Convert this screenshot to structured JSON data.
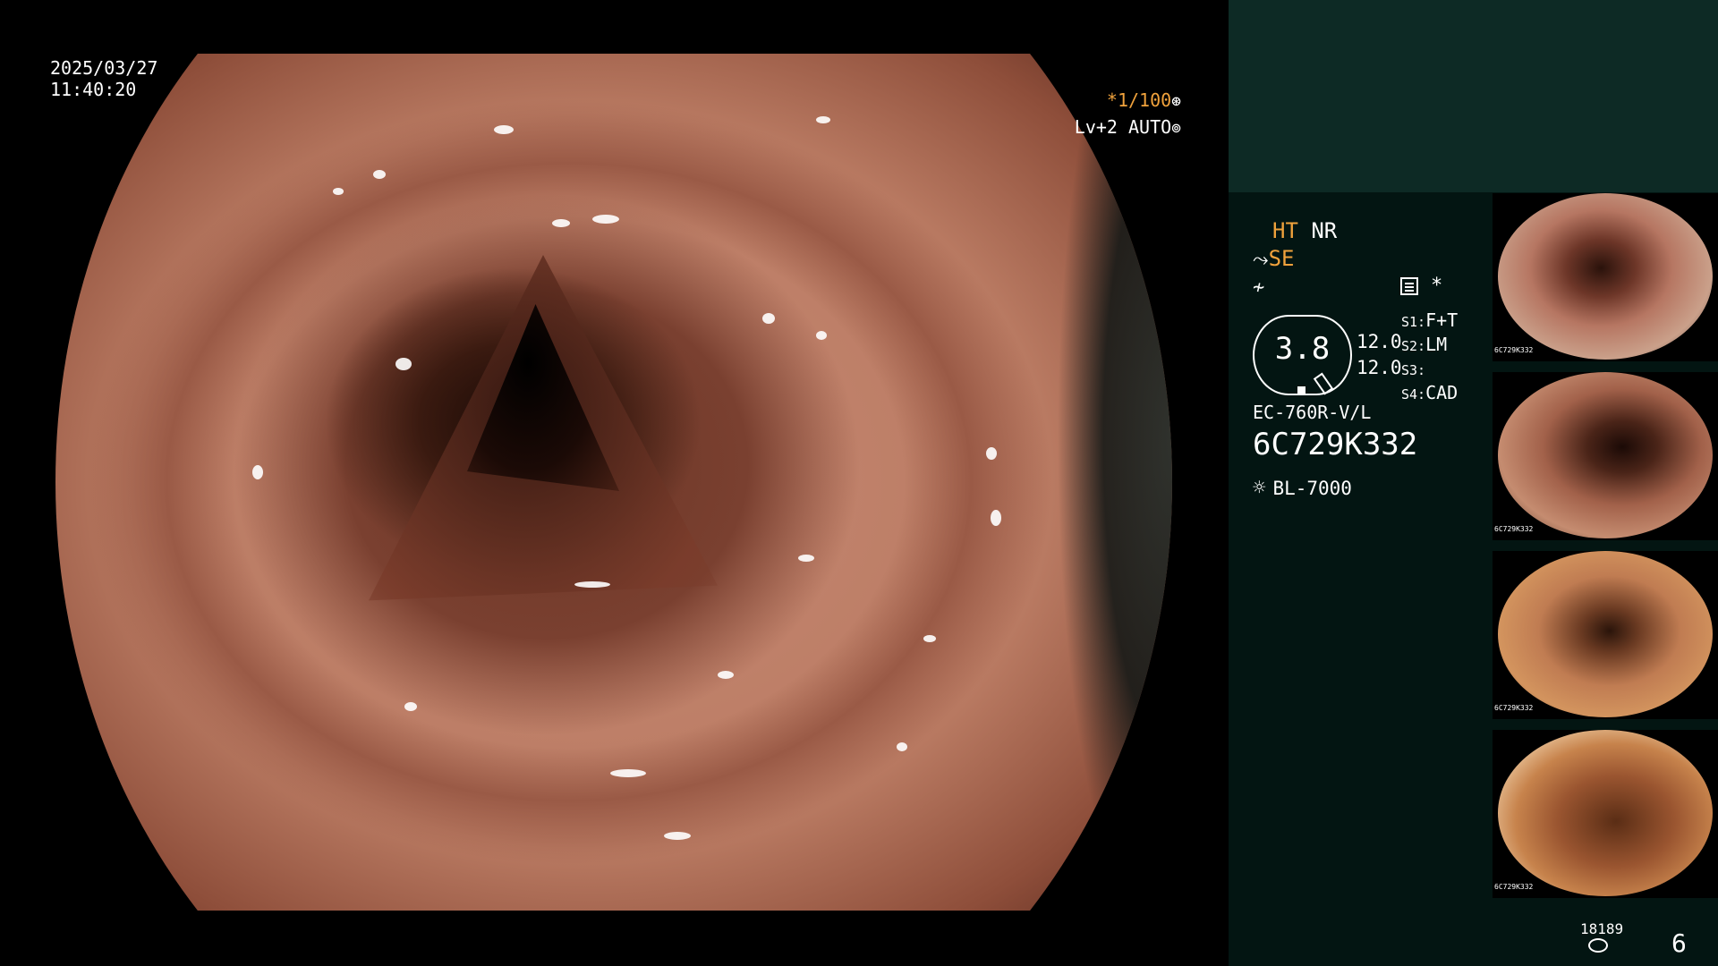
{
  "overlay": {
    "date": "2025/03/27",
    "time": "11:40:20",
    "shutter": "*1/100",
    "shutter_icon": "aperture-icon",
    "agc": "Lv+2 AUTO",
    "agc_icon": "iris-icon"
  },
  "panel": {
    "ht": "HT",
    "nr": "NR",
    "se_icon": "enhancement-icon",
    "se": "SE",
    "filter_icon": "filter-icon",
    "settings_icon": "settings-icon",
    "star": "*",
    "zoom": "3.8",
    "reading_1": "12.0",
    "reading_2": "12.0",
    "switches": [
      {
        "key": "S1:",
        "value": "F+T"
      },
      {
        "key": "S2:",
        "value": "LM"
      },
      {
        "key": "S3:",
        "value": ""
      },
      {
        "key": "S4:",
        "value": "CAD"
      }
    ],
    "scope_model": "EC-760R-V/L",
    "scope_serial": "6C729K332",
    "light_icon": "light-source-icon",
    "light_source": "BL-7000",
    "storage_count": "18189",
    "storage_icon": "disk-icon",
    "image_number": "6"
  },
  "thumbnails": [
    {
      "caption": "6C729K332"
    },
    {
      "caption": "6C729K332"
    },
    {
      "caption": "6C729K332"
    },
    {
      "caption": "6C729K332"
    }
  ],
  "colors": {
    "accent": "#f0a23c",
    "panel_top": "#0d2a25",
    "panel_bottom": "#031512"
  }
}
